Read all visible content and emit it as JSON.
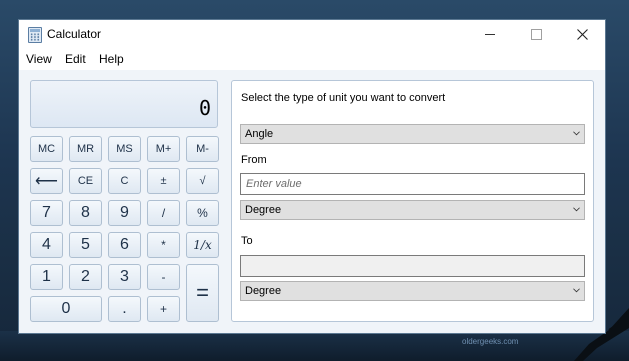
{
  "window": {
    "title": "Calculator"
  },
  "menu": [
    "View",
    "Edit",
    "Help"
  ],
  "display": {
    "value": "0"
  },
  "keys": {
    "mc": "MC",
    "mr": "MR",
    "ms": "MS",
    "mplus": "M+",
    "mminus": "M-",
    "backspace": "⟵",
    "ce": "CE",
    "c": "C",
    "plusminus": "±",
    "sqrt": "√",
    "seven": "7",
    "eight": "8",
    "nine": "9",
    "divide": "/",
    "percent": "%",
    "four": "4",
    "five": "5",
    "six": "6",
    "multiply": "*",
    "reciprocal": "1/x",
    "one": "1",
    "two": "2",
    "three": "3",
    "subtract": "-",
    "equals": "=",
    "zero": "0",
    "decimal": ".",
    "add": "+"
  },
  "converter": {
    "prompt": "Select the type of unit you want to convert",
    "type_selected": "Angle",
    "from_label": "From",
    "from_placeholder": "Enter value",
    "from_unit": "Degree",
    "to_label": "To",
    "to_value": "",
    "to_unit": "Degree"
  },
  "watermark": "oldergeeks.com",
  "icons": {
    "app": "calculator-icon",
    "minimize": "minimize-icon",
    "maximize": "maximize-icon",
    "close": "close-icon",
    "dropdown": "chevron-down-icon"
  }
}
